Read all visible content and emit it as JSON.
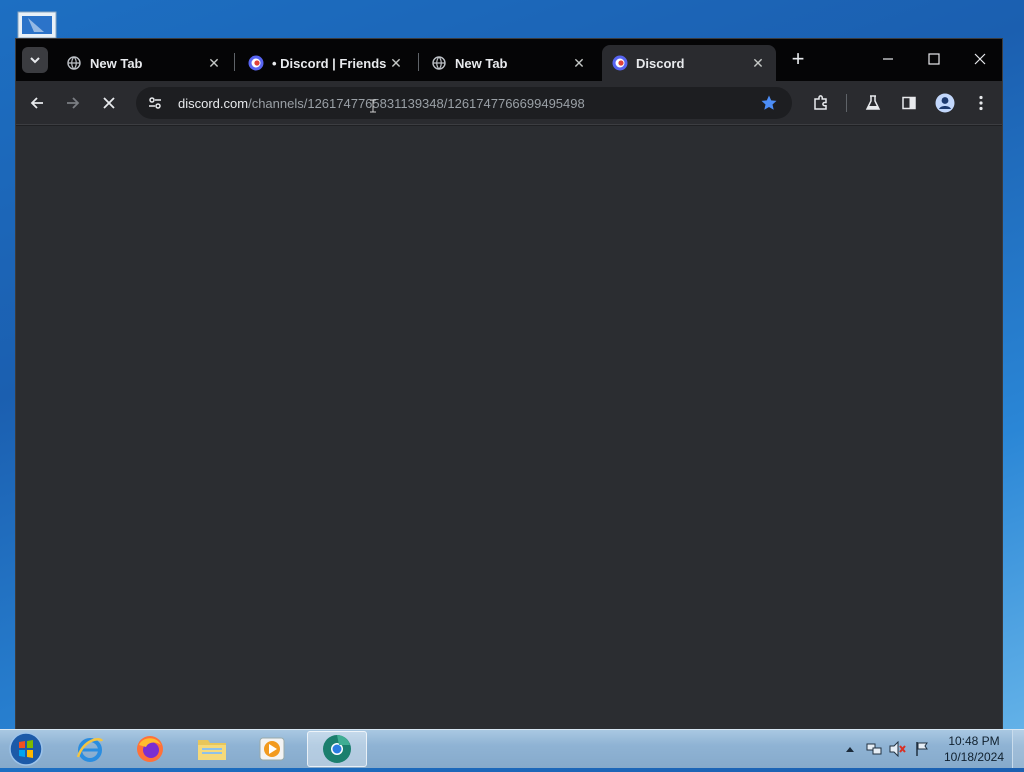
{
  "browser": {
    "tabs": [
      {
        "title": "New Tab",
        "favicon": "globe-icon",
        "active": false
      },
      {
        "title": "• Discord | Friends",
        "favicon": "discord-icon",
        "active": false
      },
      {
        "title": "New Tab",
        "favicon": "globe-icon",
        "active": false
      },
      {
        "title": "Discord",
        "favicon": "discord-icon",
        "active": true
      }
    ],
    "address_bar": {
      "host": "discord.com",
      "path": "/channels/1261747765831139348/1261747766699495498"
    },
    "bookmarked": true,
    "page_loading": true
  },
  "taskbar": {
    "apps": [
      "internet-explorer-icon",
      "firefox-icon",
      "file-explorer-icon",
      "media-player-icon",
      "chrome-dev-icon"
    ],
    "clock": {
      "time": "10:48 PM",
      "date": "10/18/2024"
    }
  },
  "colors": {
    "page_background": "#2b2d31",
    "tabstrip": "#050506",
    "toolbar": "#2a2b2f",
    "star_accent": "#4c8df6"
  }
}
